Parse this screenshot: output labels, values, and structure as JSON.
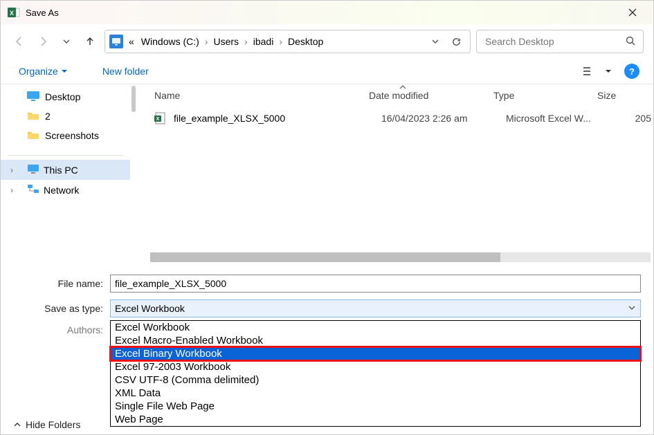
{
  "window": {
    "title": "Save As"
  },
  "breadcrumbs": {
    "overflow": "«",
    "items": [
      "Windows (C:)",
      "Users",
      "ibadi",
      "Desktop"
    ]
  },
  "search": {
    "placeholder": "Search Desktop"
  },
  "toolbar": {
    "organize": "Organize",
    "new_folder": "New folder"
  },
  "tree": {
    "desktop": "Desktop",
    "folder2": "2",
    "screenshots": "Screenshots",
    "this_pc": "This PC",
    "network": "Network"
  },
  "columns": {
    "name": "Name",
    "date": "Date modified",
    "type": "Type",
    "size": "Size"
  },
  "files": [
    {
      "name": "file_example_XLSX_5000",
      "date": "16/04/2023 2:26 am",
      "type": "Microsoft Excel W...",
      "size": "205"
    }
  ],
  "form": {
    "file_name_label": "File name:",
    "file_name_value": "file_example_XLSX_5000",
    "save_type_label": "Save as type:",
    "save_type_value": "Excel Workbook",
    "authors_label": "Authors:"
  },
  "type_options": [
    "Excel Workbook",
    "Excel Macro-Enabled Workbook",
    "Excel Binary Workbook",
    "Excel 97-2003 Workbook",
    "CSV UTF-8 (Comma delimited)",
    "XML Data",
    "Single File Web Page",
    "Web Page"
  ],
  "highlighted_option_index": 2,
  "footer": {
    "hide_folders": "Hide Folders"
  }
}
